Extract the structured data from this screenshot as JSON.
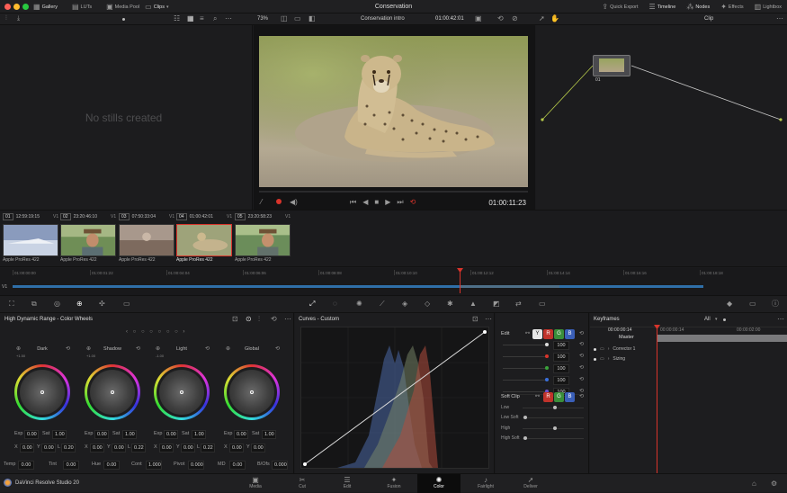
{
  "window": {
    "title": "Conservation"
  },
  "titlebar": {
    "left_tabs": [
      {
        "label": "Gallery",
        "icon": "gallery-icon"
      },
      {
        "label": "LUTs",
        "icon": "luts-icon"
      },
      {
        "label": "Media Pool",
        "icon": "media-pool-icon"
      },
      {
        "label": "Clips",
        "icon": "clips-icon"
      }
    ],
    "right_tabs": [
      {
        "label": "Quick Export",
        "icon": "upload-icon"
      },
      {
        "label": "Timeline",
        "icon": "timeline-icon"
      },
      {
        "label": "Nodes",
        "icon": "nodes-icon"
      },
      {
        "label": "Effects",
        "icon": "effects-icon"
      },
      {
        "label": "Lightbox",
        "icon": "lightbox-icon"
      }
    ]
  },
  "toolbar": {
    "zoom": "73%",
    "timeline_name": "Conservation intro",
    "timecode": "01:00:42:01",
    "node_mode": "Clip"
  },
  "gallery": {
    "empty_text": "No stills created"
  },
  "viewer": {
    "timecode": "01:00:11:23"
  },
  "node": {
    "label": "01"
  },
  "clips": [
    {
      "num": "01",
      "tc": "12:59:19:15",
      "track": "V1",
      "codec": "Apple ProRes 422"
    },
    {
      "num": "02",
      "tc": "23:20:46:10",
      "track": "V1",
      "codec": "Apple ProRes 422"
    },
    {
      "num": "03",
      "tc": "07:50:33:04",
      "track": "V1",
      "codec": "Apple ProRes 422"
    },
    {
      "num": "04",
      "tc": "01:00:42:01",
      "track": "V1",
      "codec": "Apple ProRes 422"
    },
    {
      "num": "05",
      "tc": "23:20:58:23",
      "track": "V1",
      "codec": "Apple ProRes 422"
    }
  ],
  "ruler": {
    "ticks": [
      "01:00:00:00",
      "01:00:01:22",
      "01:00:04:04",
      "01:00:06:06",
      "01:00:08:08",
      "01:00:10:10",
      "01:00:12:12",
      "01:00:14:14",
      "01:00:16:16",
      "01:00:18:18"
    ],
    "track": "V1"
  },
  "wheels_panel": {
    "title": "High Dynamic Range - Color Wheels",
    "wheels": [
      {
        "name": "Dark",
        "sub": "+1.50",
        "exp": "0.00",
        "sat": "1.00",
        "x": "0.00",
        "y": "0.00",
        "l": "0.20",
        "l_label": "L"
      },
      {
        "name": "Shadow",
        "sub": "+1.00",
        "exp": "0.00",
        "sat": "1.00",
        "x": "0.00",
        "y": "0.00",
        "l": "0.22",
        "l_label": "L"
      },
      {
        "name": "Light",
        "sub": "-1.00",
        "exp": "0.00",
        "sat": "1.00",
        "x": "0.00",
        "y": "0.00",
        "l": "0.22",
        "l_label": "L"
      },
      {
        "name": "Global",
        "sub": "",
        "exp": "0.00",
        "sat": "1.00",
        "x": "0.00",
        "y": "0.00",
        "l": "",
        "l_label": ""
      }
    ],
    "bottom": [
      {
        "label": "Temp",
        "value": "0.00"
      },
      {
        "label": "Tint",
        "value": "0.00"
      },
      {
        "label": "Hue",
        "value": "0.00"
      },
      {
        "label": "Cont",
        "value": "1.000"
      },
      {
        "label": "Pivot",
        "value": "0.000"
      },
      {
        "label": "MD",
        "value": "0.00"
      },
      {
        "label": "B/Ofs",
        "value": "0.000"
      }
    ]
  },
  "curves_panel": {
    "title": "Curves - Custom"
  },
  "edit_panel": {
    "title": "Edit",
    "channels": [
      "Y",
      "R",
      "G",
      "B"
    ],
    "values": [
      "100",
      "100",
      "100",
      "100",
      "100"
    ],
    "soft_clip": "Soft Clip",
    "soft_labels": [
      "Low",
      "Low Soft",
      "High",
      "High Soft"
    ]
  },
  "keyframes": {
    "title": "Keyframes",
    "filter": "All",
    "tc_current": "00:00:00:14",
    "tc_next": "00:00:02:00",
    "rows": [
      "Master",
      "Corrector 1",
      "Sizing"
    ]
  },
  "footer": {
    "app": "DaVinci Resolve Studio 20",
    "pages": [
      {
        "label": "Media",
        "icon": "media-icon"
      },
      {
        "label": "Cut",
        "icon": "cut-icon"
      },
      {
        "label": "Edit",
        "icon": "edit-icon"
      },
      {
        "label": "Fusion",
        "icon": "fusion-icon"
      },
      {
        "label": "Color",
        "icon": "color-icon"
      },
      {
        "label": "Fairlight",
        "icon": "fairlight-icon"
      },
      {
        "label": "Deliver",
        "icon": "deliver-icon"
      }
    ],
    "active_page": "Color"
  },
  "colors": {
    "accent_red": "#d9342b",
    "clip_blue": "#2f6fa8",
    "panel": "#1b1b1d"
  }
}
